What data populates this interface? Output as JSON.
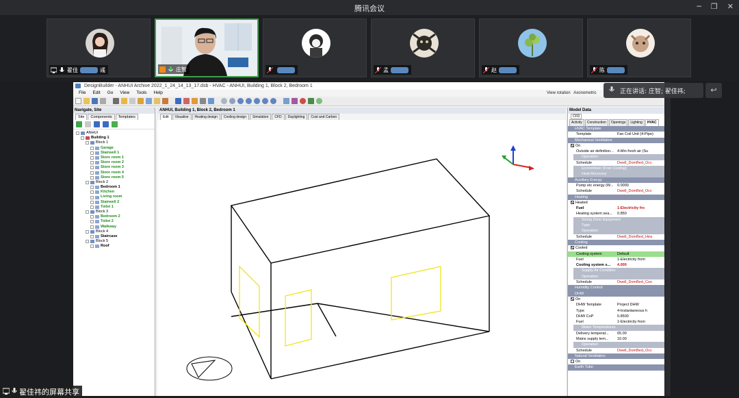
{
  "app": {
    "title": "腾讯会议"
  },
  "participants": [
    {
      "name_visible": "翟佳",
      "name_tail": "彧",
      "mic": "on",
      "screen_sharing": true,
      "active": false,
      "avatar": "woman-photo"
    },
    {
      "name_visible": "庄智",
      "name_tail": "",
      "mic": "on",
      "screen_sharing": false,
      "active": true,
      "avatar": "camera-video"
    },
    {
      "name_visible": "",
      "name_tail": "",
      "mic": "off",
      "screen_sharing": false,
      "active": false,
      "avatar": "girl-drawing"
    },
    {
      "name_visible": "孟",
      "name_tail": "",
      "mic": "off",
      "screen_sharing": false,
      "active": false,
      "avatar": "cat-photo"
    },
    {
      "name_visible": "赵",
      "name_tail": "",
      "mic": "off",
      "screen_sharing": false,
      "active": false,
      "avatar": "plant-photo"
    },
    {
      "name_visible": "陈",
      "name_tail": "",
      "mic": "off",
      "screen_sharing": false,
      "active": false,
      "avatar": "pet-photo"
    }
  ],
  "speaking_banner": "正在讲话: 庄智; 翟佳祎;",
  "share_tag": "翟佳祎的屏幕共享",
  "designbuilder": {
    "window_title": "DesignBuilder - ANHUI Archive 2022_1_24_14_13_17.dsb - HVAC - ANHUI, Building 1, Block 2, Bedroom 1",
    "menu": [
      "File",
      "Edit",
      "Go",
      "View",
      "Tools",
      "Help"
    ],
    "view_rotation_label": "View rotation",
    "view_rotation_value": "Axonometric",
    "navigator": {
      "title": "Navigate, Site",
      "tabs": [
        "Site",
        "Components",
        "Templates"
      ],
      "tree": [
        {
          "label": "ANHUI",
          "level": 0,
          "style": "plain"
        },
        {
          "label": "Building 1",
          "level": 1,
          "style": "bold"
        },
        {
          "label": "Block 1",
          "level": 2,
          "style": "plain"
        },
        {
          "label": "Garage",
          "level": 3,
          "style": "zone"
        },
        {
          "label": "Stairwell 1",
          "level": 3,
          "style": "zone"
        },
        {
          "label": "Store room 1",
          "level": 3,
          "style": "zone"
        },
        {
          "label": "Store room 2",
          "level": 3,
          "style": "zone"
        },
        {
          "label": "Store room 3",
          "level": 3,
          "style": "zone"
        },
        {
          "label": "Store room 4",
          "level": 3,
          "style": "zone"
        },
        {
          "label": "Store room 5",
          "level": 3,
          "style": "zone"
        },
        {
          "label": "Block 2",
          "level": 2,
          "style": "plain"
        },
        {
          "label": "Bedroom 1",
          "level": 3,
          "style": "zone-bold"
        },
        {
          "label": "Kitchen",
          "level": 3,
          "style": "zone"
        },
        {
          "label": "Living room",
          "level": 3,
          "style": "zone"
        },
        {
          "label": "Stairwell 2",
          "level": 3,
          "style": "zone"
        },
        {
          "label": "Toilet 1",
          "level": 3,
          "style": "zone"
        },
        {
          "label": "Block 3",
          "level": 2,
          "style": "plain"
        },
        {
          "label": "Bedroom 2",
          "level": 3,
          "style": "zone"
        },
        {
          "label": "Toilet 2",
          "level": 3,
          "style": "zone"
        },
        {
          "label": "Walkway",
          "level": 3,
          "style": "zone"
        },
        {
          "label": "Block 4",
          "level": 2,
          "style": "plain"
        },
        {
          "label": "Staircase",
          "level": 3,
          "style": "zone-bold"
        },
        {
          "label": "Block 5",
          "level": 2,
          "style": "plain"
        },
        {
          "label": "Roof",
          "level": 3,
          "style": "zone-bold"
        }
      ]
    },
    "center": {
      "title": "ANHUI, Building 1, Block 2, Bedroom 1",
      "tabs": [
        "Edit",
        "Visualise",
        "Heating design",
        "Cooling design",
        "Simulation",
        "CFD",
        "Daylighting",
        "Cost and Carbon"
      ],
      "active_tab": "Edit"
    },
    "model_data": {
      "title": "Model Data",
      "cfd_tab": "CFD",
      "tabs": [
        "Activity",
        "Construction",
        "Openings",
        "Lighting",
        "HVAC"
      ],
      "active_tab": "HVAC",
      "rows": [
        {
          "type": "hdr",
          "text": "HVAC Template"
        },
        {
          "type": "kv",
          "key": "Template",
          "value": "Fan Coil Unit (4-Pipe)"
        },
        {
          "type": "hdr",
          "text": "Mechanical Ventilation"
        },
        {
          "type": "check",
          "key": "On",
          "checked": true
        },
        {
          "type": "kv",
          "key": "Outside air definition...",
          "value": "4-Min fresh air (Su"
        },
        {
          "type": "sub",
          "text": "Operation"
        },
        {
          "type": "kv",
          "key": "Schedule",
          "value": "Dwell_DomBed_Occ",
          "red": true
        },
        {
          "type": "sub",
          "text": "Economiser (Free Cooling)"
        },
        {
          "type": "sub",
          "text": "Heat Recovery"
        },
        {
          "type": "hdr",
          "text": "Auxiliary Energy"
        },
        {
          "type": "kv",
          "key": "Pump etc energy (W...",
          "value": "0.0000"
        },
        {
          "type": "kv",
          "key": "Schedule",
          "value": "Dwell_DomBed_Occ",
          "red": true
        },
        {
          "type": "hdr",
          "text": "Heating"
        },
        {
          "type": "check",
          "key": "Heated",
          "checked": true
        },
        {
          "type": "kv",
          "key": "Fuel",
          "value": "1-Electricity fro",
          "red": true,
          "bold": true
        },
        {
          "type": "kv",
          "key": "Heating system sea...",
          "value": "0.850"
        },
        {
          "type": "sub",
          "text": "Sizing Zone Equipment"
        },
        {
          "type": "sub",
          "text": "Type"
        },
        {
          "type": "sub",
          "text": "Operation"
        },
        {
          "type": "kv",
          "key": "Schedule",
          "value": "Dwell_DomBed_Hea",
          "red": true
        },
        {
          "type": "hdr",
          "text": "Cooling"
        },
        {
          "type": "check",
          "key": "Cooled",
          "checked": true
        },
        {
          "type": "kv",
          "key": "Cooling system",
          "value": "Default",
          "green": true
        },
        {
          "type": "kv",
          "key": "Fuel",
          "value": "1-Electricity from"
        },
        {
          "type": "kv",
          "key": "Cooling system s...",
          "value": "4.000",
          "red": true,
          "bold": true
        },
        {
          "type": "sub",
          "text": "Supply Air Condition"
        },
        {
          "type": "sub",
          "text": "Operation"
        },
        {
          "type": "kv",
          "key": "Schedule",
          "value": "Dwell_DomBed_Coo",
          "red": true
        },
        {
          "type": "hdr",
          "text": "Humidity Control"
        },
        {
          "type": "hdr",
          "text": "DHW"
        },
        {
          "type": "check",
          "key": "On",
          "checked": true
        },
        {
          "type": "kv",
          "key": "DHW Template",
          "value": "Project DHW"
        },
        {
          "type": "kv",
          "key": "Type",
          "value": "4-Instantaneous h"
        },
        {
          "type": "kv",
          "key": "DHW CoP",
          "value": "0.8500"
        },
        {
          "type": "kv",
          "key": "Fuel",
          "value": "1-Electricity from"
        },
        {
          "type": "sub",
          "text": "Water Temperatures"
        },
        {
          "type": "kv",
          "key": "Delivery temperat...",
          "value": "65.00"
        },
        {
          "type": "kv",
          "key": "Mains supply tem...",
          "value": "10.00"
        },
        {
          "type": "sub",
          "text": "Operation"
        },
        {
          "type": "kv",
          "key": "Schedule",
          "value": "Dwell_DomBed_Occ",
          "red": true
        },
        {
          "type": "hdr",
          "text": "Natural Ventilation"
        },
        {
          "type": "check",
          "key": "On",
          "checked": false
        },
        {
          "type": "hdr",
          "text": "Earth Tube"
        }
      ]
    }
  }
}
